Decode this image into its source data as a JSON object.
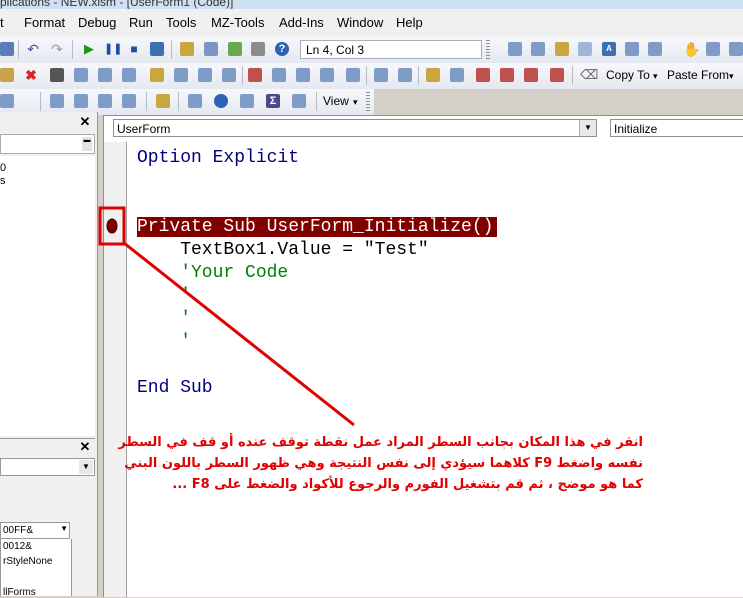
{
  "title": "plications - NEW.xlsm - [UserForm1 (Code)]",
  "menu": [
    "t",
    "Format",
    "Debug",
    "Run",
    "Tools",
    "MZ-Tools",
    "Add-Ins",
    "Window",
    "Help"
  ],
  "toolbar": {
    "status": "Ln 4, Col 3",
    "copy_to": "Copy To",
    "paste_from": "Paste From",
    "view": "View"
  },
  "left_pane": {
    "top_items": [
      "0",
      "s"
    ],
    "props": [
      "00FF&",
      "0012&",
      "rStyleNone",
      "llForms"
    ]
  },
  "code_window": {
    "object_combo": "UserForm",
    "proc_combo": "Initialize",
    "lines": {
      "option": "Option Explicit",
      "sub": "Private Sub UserForm_Initialize()",
      "textbox": "    TextBox1.Value = \"Test\"",
      "comment1": "    'Your Code",
      "comment2": "    '",
      "comment3": "    '",
      "comment4": "    '",
      "endsub": "End Sub"
    }
  },
  "annotation": {
    "line1": "انقر في هذا المكان بجانب السطر المراد عمل نقطة توقف عنده أو قف في السطر",
    "line2": "نفسه واضغط F9 كلاهما سيؤدي إلى نفس النتيجة وهي ظهور السطر باللون البني",
    "line3": "كما هو موضح ، ثم قم بتشغيل الفورم والرجوع للأكواد والضغط على F8 ..."
  },
  "colors": {
    "breakpoint": "#800000",
    "keyword": "#00007f",
    "comment": "#008000",
    "annotation": "#e00000"
  }
}
